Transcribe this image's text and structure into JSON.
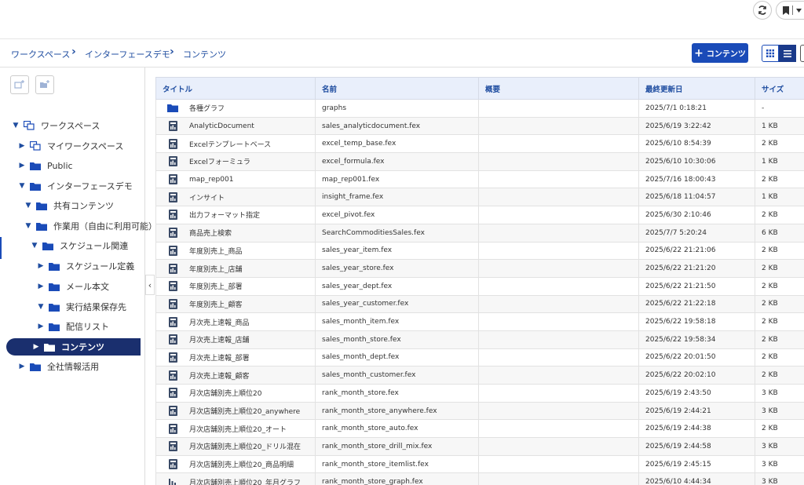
{
  "breadcrumb": [
    "ワークスペース",
    "インターフェースデモ",
    "コンテンツ"
  ],
  "toolbar": {
    "add_label": "コンテンツ"
  },
  "colors": {
    "accent": "#1a4bb8",
    "selected": "#1a2f6e",
    "header_bg": "#e9effb"
  },
  "tree": [
    {
      "label": "ワークスペース",
      "arrow": "down",
      "icon": "workspace-icon",
      "indent": 0
    },
    {
      "label": "マイワークスペース",
      "arrow": "right",
      "icon": "workspace-icon",
      "indent": 1
    },
    {
      "label": "Public",
      "arrow": "right",
      "icon": "folder-icon",
      "indent": 1
    },
    {
      "label": "インターフェースデモ",
      "arrow": "down",
      "icon": "folder-icon",
      "indent": 1
    },
    {
      "label": "共有コンテンツ",
      "arrow": "down",
      "icon": "folder-icon",
      "indent": 2
    },
    {
      "label": "作業用（自由に利用可能）",
      "arrow": "down",
      "icon": "folder-icon",
      "indent": 2
    },
    {
      "label": "スケジュール関連",
      "arrow": "down",
      "icon": "folder-icon",
      "indent": 3
    },
    {
      "label": "スケジュール定義",
      "arrow": "right",
      "icon": "folder-icon",
      "indent": 4
    },
    {
      "label": "メール本文",
      "arrow": "right",
      "icon": "folder-icon",
      "indent": 4
    },
    {
      "label": "実行結果保存先",
      "arrow": "down",
      "icon": "folder-icon",
      "indent": 4
    },
    {
      "label": "配信リスト",
      "arrow": "right",
      "icon": "folder-icon",
      "indent": 4
    },
    {
      "label": "コンテンツ",
      "arrow": "right",
      "icon": "folder-icon",
      "indent": 2,
      "selected": true
    },
    {
      "label": "全社情報活用",
      "arrow": "right",
      "icon": "folder-icon",
      "indent": 1
    }
  ],
  "table": {
    "columns": [
      "タイトル",
      "名前",
      "概要",
      "最終更新日",
      "サイズ"
    ],
    "rows": [
      {
        "icon": "folder-icon",
        "title": "各種グラフ",
        "name": "graphs",
        "summary": "",
        "updated": "2025/7/1 0:18:21",
        "size": "-"
      },
      {
        "icon": "document-icon",
        "title": "AnalyticDocument",
        "name": "sales_analyticdocument.fex",
        "summary": "",
        "updated": "2025/6/19 3:22:42",
        "size": "1 KB"
      },
      {
        "icon": "document-icon",
        "title": "Excelテンプレートベース",
        "name": "excel_temp_base.fex",
        "summary": "",
        "updated": "2025/6/10 8:54:39",
        "size": "2 KB"
      },
      {
        "icon": "document-icon",
        "title": "Excelフォーミュラ",
        "name": "excel_formula.fex",
        "summary": "",
        "updated": "2025/6/10 10:30:06",
        "size": "1 KB"
      },
      {
        "icon": "document-icon",
        "title": "map_rep001",
        "name": "map_rep001.fex",
        "summary": "",
        "updated": "2025/7/16 18:00:43",
        "size": "2 KB"
      },
      {
        "icon": "document-icon",
        "title": "インサイト",
        "name": "insight_frame.fex",
        "summary": "",
        "updated": "2025/6/18 11:04:57",
        "size": "1 KB"
      },
      {
        "icon": "document-icon",
        "title": "出力フォーマット指定",
        "name": "excel_pivot.fex",
        "summary": "",
        "updated": "2025/6/30 2:10:46",
        "size": "2 KB"
      },
      {
        "icon": "document-icon",
        "title": "商品売上検索",
        "name": "SearchCommoditiesSales.fex",
        "summary": "",
        "updated": "2025/7/7 5:20:24",
        "size": "6 KB"
      },
      {
        "icon": "document-icon",
        "title": "年度別売上_商品",
        "name": "sales_year_item.fex",
        "summary": "",
        "updated": "2025/6/22 21:21:06",
        "size": "2 KB"
      },
      {
        "icon": "document-icon",
        "title": "年度別売上_店舗",
        "name": "sales_year_store.fex",
        "summary": "",
        "updated": "2025/6/22 21:21:20",
        "size": "2 KB"
      },
      {
        "icon": "document-icon",
        "title": "年度別売上_部署",
        "name": "sales_year_dept.fex",
        "summary": "",
        "updated": "2025/6/22 21:21:50",
        "size": "2 KB"
      },
      {
        "icon": "document-icon",
        "title": "年度別売上_顧客",
        "name": "sales_year_customer.fex",
        "summary": "",
        "updated": "2025/6/22 21:22:18",
        "size": "2 KB"
      },
      {
        "icon": "document-icon",
        "title": "月次売上速報_商品",
        "name": "sales_month_item.fex",
        "summary": "",
        "updated": "2025/6/22 19:58:18",
        "size": "2 KB"
      },
      {
        "icon": "document-icon",
        "title": "月次売上速報_店舗",
        "name": "sales_month_store.fex",
        "summary": "",
        "updated": "2025/6/22 19:58:34",
        "size": "2 KB"
      },
      {
        "icon": "document-icon",
        "title": "月次売上速報_部署",
        "name": "sales_month_dept.fex",
        "summary": "",
        "updated": "2025/6/22 20:01:50",
        "size": "2 KB"
      },
      {
        "icon": "document-icon",
        "title": "月次売上速報_顧客",
        "name": "sales_month_customer.fex",
        "summary": "",
        "updated": "2025/6/22 20:02:10",
        "size": "2 KB"
      },
      {
        "icon": "document-icon",
        "title": "月次店舗別売上順位20",
        "name": "rank_month_store.fex",
        "summary": "",
        "updated": "2025/6/19 2:43:50",
        "size": "3 KB"
      },
      {
        "icon": "document-icon",
        "title": "月次店舗別売上順位20_anywhere",
        "name": "rank_month_store_anywhere.fex",
        "summary": "",
        "updated": "2025/6/19 2:44:21",
        "size": "3 KB"
      },
      {
        "icon": "document-icon",
        "title": "月次店舗別売上順位20_オート",
        "name": "rank_month_store_auto.fex",
        "summary": "",
        "updated": "2025/6/19 2:44:38",
        "size": "2 KB"
      },
      {
        "icon": "document-icon",
        "title": "月次店舗別売上順位20_ドリル混在",
        "name": "rank_month_store_drill_mix.fex",
        "summary": "",
        "updated": "2025/6/19 2:44:58",
        "size": "3 KB"
      },
      {
        "icon": "document-icon",
        "title": "月次店舗別売上順位20_商品明細",
        "name": "rank_month_store_itemlist.fex",
        "summary": "",
        "updated": "2025/6/19 2:45:15",
        "size": "3 KB"
      },
      {
        "icon": "bar-chart-icon",
        "title": "月次店舗別売上順位20_年月グラフ",
        "name": "rank_month_store_graph.fex",
        "summary": "",
        "updated": "2025/6/10 4:44:34",
        "size": "3 KB"
      }
    ]
  }
}
